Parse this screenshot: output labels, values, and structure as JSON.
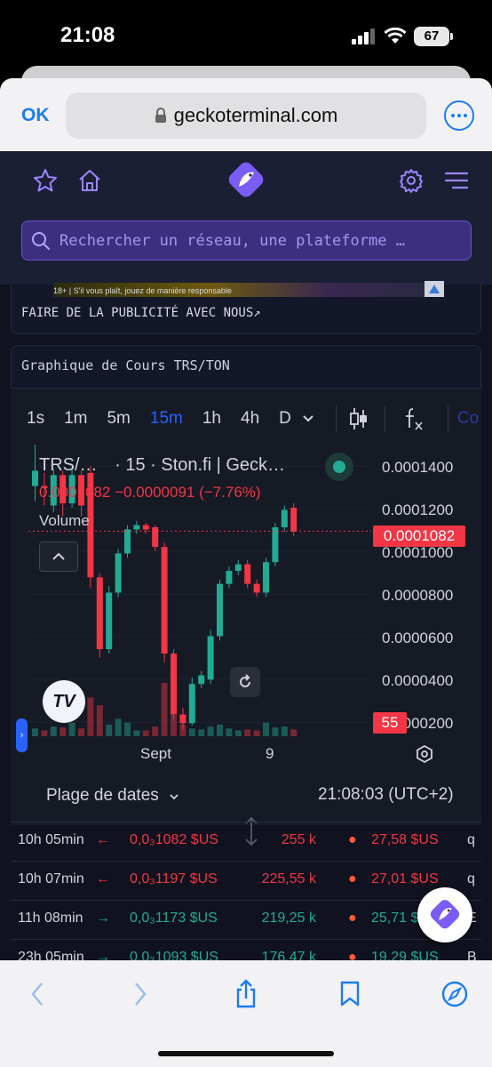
{
  "status_bar": {
    "time": "21:08",
    "battery": "67"
  },
  "safari": {
    "done_label": "OK",
    "url": "geckoterminal.com"
  },
  "search": {
    "placeholder": "Rechercher un réseau, une plateforme …"
  },
  "ad": {
    "banner_text": "18+ | S'il vous plaît, jouez de manière responsable",
    "link_label": "FAIRE DE LA PUBLICITÉ AVEC NOUS↗"
  },
  "chart_card": {
    "title": "Graphique de Cours TRS/TON"
  },
  "toolbar": {
    "intervals": [
      "1s",
      "1m",
      "5m",
      "15m",
      "1h",
      "4h",
      "D"
    ],
    "active_interval": "15m",
    "next_label": "Co"
  },
  "legend": {
    "pair": "TRS/…",
    "source": "· 15 · Ston.fi | Geck…",
    "ohlc": "0.0001082  −0.0000091 (−7.76%)",
    "volume_label": "Volume"
  },
  "price_axis": {
    "labels": [
      "0.0001400",
      "0.0001200",
      "0.0001000",
      "0.0000800",
      "0.0000600",
      "0.0000400",
      "0.0000200"
    ],
    "last_price": "0.0001082",
    "last_volume": "55"
  },
  "time_axis": {
    "labels": [
      "Sept",
      "9"
    ]
  },
  "footer": {
    "date_range_label": "Plage de dates",
    "clock": "21:08:03 (UTC+2)"
  },
  "trades": [
    {
      "age": "10h 05min",
      "side": "sell",
      "price": "0,0₃1082 $US",
      "volume": "255 k",
      "amount": "27,58 $US",
      "maker": "q"
    },
    {
      "age": "10h 07min",
      "side": "sell",
      "price": "0,0₃1197 $US",
      "volume": "225,55 k",
      "amount": "27,01 $US",
      "maker": "q"
    },
    {
      "age": "11h 08min",
      "side": "buy",
      "price": "0,0₃1173 $US",
      "volume": "219,25 k",
      "amount": "25,71 $US",
      "maker": "E"
    },
    {
      "age": "23h 05min",
      "side": "buy",
      "price": "0,0₃1093 $US",
      "volume": "176,47 k",
      "amount": "19,29 $US",
      "maker": "B"
    }
  ],
  "colors": {
    "up": "#22ab94",
    "down": "#f23645",
    "accent": "#2962ff",
    "brand": "#7b5cf5"
  },
  "chart_data": {
    "type": "candlestick",
    "pair": "TRS/TON",
    "interval": "15",
    "y_range": [
      1.4e-05,
      0.000148
    ],
    "x_labels": [
      "Sept",
      "9"
    ],
    "candles": [
      {
        "o": 0.000129,
        "c": 0.000136,
        "h": 0.000148,
        "l": 0.000122,
        "v": 8
      },
      {
        "o": 0.000129,
        "c": 0.000128,
        "h": 0.000135,
        "l": 0.00012,
        "v": 6
      },
      {
        "o": 0.00012,
        "c": 0.000134,
        "h": 0.000137,
        "l": 0.000117,
        "v": 10
      },
      {
        "o": 0.000134,
        "c": 0.000121,
        "h": 0.000136,
        "l": 0.000115,
        "v": 9
      },
      {
        "o": 0.000121,
        "c": 0.000134,
        "h": 0.000138,
        "l": 0.000119,
        "v": 14
      },
      {
        "o": 0.000134,
        "c": 0.00012,
        "h": 0.000136,
        "l": 0.000115,
        "v": 8
      },
      {
        "o": 0.000135,
        "c": 8.7e-05,
        "h": 0.000138,
        "l": 8.2e-05,
        "v": 40
      },
      {
        "o": 8.7e-05,
        "c": 5.4e-05,
        "h": 8.9e-05,
        "l": 5e-05,
        "v": 32
      },
      {
        "o": 5.4e-05,
        "c": 8e-05,
        "h": 8.3e-05,
        "l": 5.2e-05,
        "v": 12
      },
      {
        "o": 8e-05,
        "c": 9.8e-05,
        "h": 0.0001,
        "l": 7.8e-05,
        "v": 18
      },
      {
        "o": 9.8e-05,
        "c": 0.000109,
        "h": 0.000111,
        "l": 9.6e-05,
        "v": 14
      },
      {
        "o": 0.000109,
        "c": 0.000111,
        "h": 0.000113,
        "l": 0.000107,
        "v": 6
      },
      {
        "o": 0.000111,
        "c": 0.000109,
        "h": 0.000112,
        "l": 0.000107,
        "v": 6
      },
      {
        "o": 0.00011,
        "c": 0.000101,
        "h": 0.000111,
        "l": 9.9e-05,
        "v": 10
      },
      {
        "o": 0.000101,
        "c": 5.2e-05,
        "h": 0.000103,
        "l": 4.8e-05,
        "v": 55
      },
      {
        "o": 5.2e-05,
        "c": 2.4e-05,
        "h": 5.4e-05,
        "l": 2.2e-05,
        "v": 22
      },
      {
        "o": 2.4e-05,
        "c": 2e-05,
        "h": 2.7e-05,
        "l": 1.7e-05,
        "v": 12
      },
      {
        "o": 2e-05,
        "c": 3.8e-05,
        "h": 4.1e-05,
        "l": 1.9e-05,
        "v": 8
      },
      {
        "o": 3.8e-05,
        "c": 4.2e-05,
        "h": 4.4e-05,
        "l": 3.6e-05,
        "v": 7
      },
      {
        "o": 4e-05,
        "c": 6e-05,
        "h": 6.3e-05,
        "l": 3.8e-05,
        "v": 10
      },
      {
        "o": 6e-05,
        "c": 8.4e-05,
        "h": 8.6e-05,
        "l": 5.8e-05,
        "v": 12
      },
      {
        "o": 8.4e-05,
        "c": 9e-05,
        "h": 9.2e-05,
        "l": 8.2e-05,
        "v": 8
      },
      {
        "o": 9e-05,
        "c": 9.3e-05,
        "h": 9.5e-05,
        "l": 8.8e-05,
        "v": 6
      },
      {
        "o": 9.3e-05,
        "c": 8.4e-05,
        "h": 9.5e-05,
        "l": 8.2e-05,
        "v": 7
      },
      {
        "o": 8.4e-05,
        "c": 8e-05,
        "h": 8.6e-05,
        "l": 7.8e-05,
        "v": 6
      },
      {
        "o": 8e-05,
        "c": 9.4e-05,
        "h": 9.6e-05,
        "l": 7.8e-05,
        "v": 14
      },
      {
        "o": 9.4e-05,
        "c": 0.00011,
        "h": 0.000112,
        "l": 9.2e-05,
        "v": 9
      },
      {
        "o": 0.00011,
        "c": 0.000118,
        "h": 0.00012,
        "l": 0.000108,
        "v": 10
      },
      {
        "o": 0.000119,
        "c": 0.000108,
        "h": 0.000121,
        "l": 0.000106,
        "v": 7
      }
    ],
    "last_price": 0.0001082,
    "change": -9.1e-06,
    "change_pct": -7.76
  }
}
